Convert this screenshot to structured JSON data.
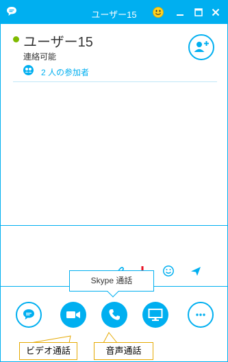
{
  "window": {
    "title": "ユーザー15",
    "title_icon": "chat-bubble-icon",
    "mood_icon": "smiley-icon",
    "controls": [
      "minimize-icon",
      "maximize-icon",
      "close-icon"
    ]
  },
  "header": {
    "contact_name": "ユーザー15",
    "status": "連絡可能",
    "participants": "2 人の参加者",
    "add_person_icon": "add-person-icon"
  },
  "compose": {
    "placeholder": "",
    "tools": [
      "attachment-icon",
      "ink-icon",
      "emoticon-icon",
      "send-icon"
    ]
  },
  "call_bar": {
    "buttons": [
      "im-button",
      "video-call-button",
      "voice-call-button",
      "screen-share-button",
      "more-options-button"
    ]
  },
  "tooltip": {
    "voice": "Skype 通話"
  },
  "callouts": {
    "video": "ビデオ通話",
    "voice": "音声通話"
  },
  "colors": {
    "accent": "#00aff0",
    "presence": "#7fba00",
    "callout_border": "#e5a800"
  }
}
